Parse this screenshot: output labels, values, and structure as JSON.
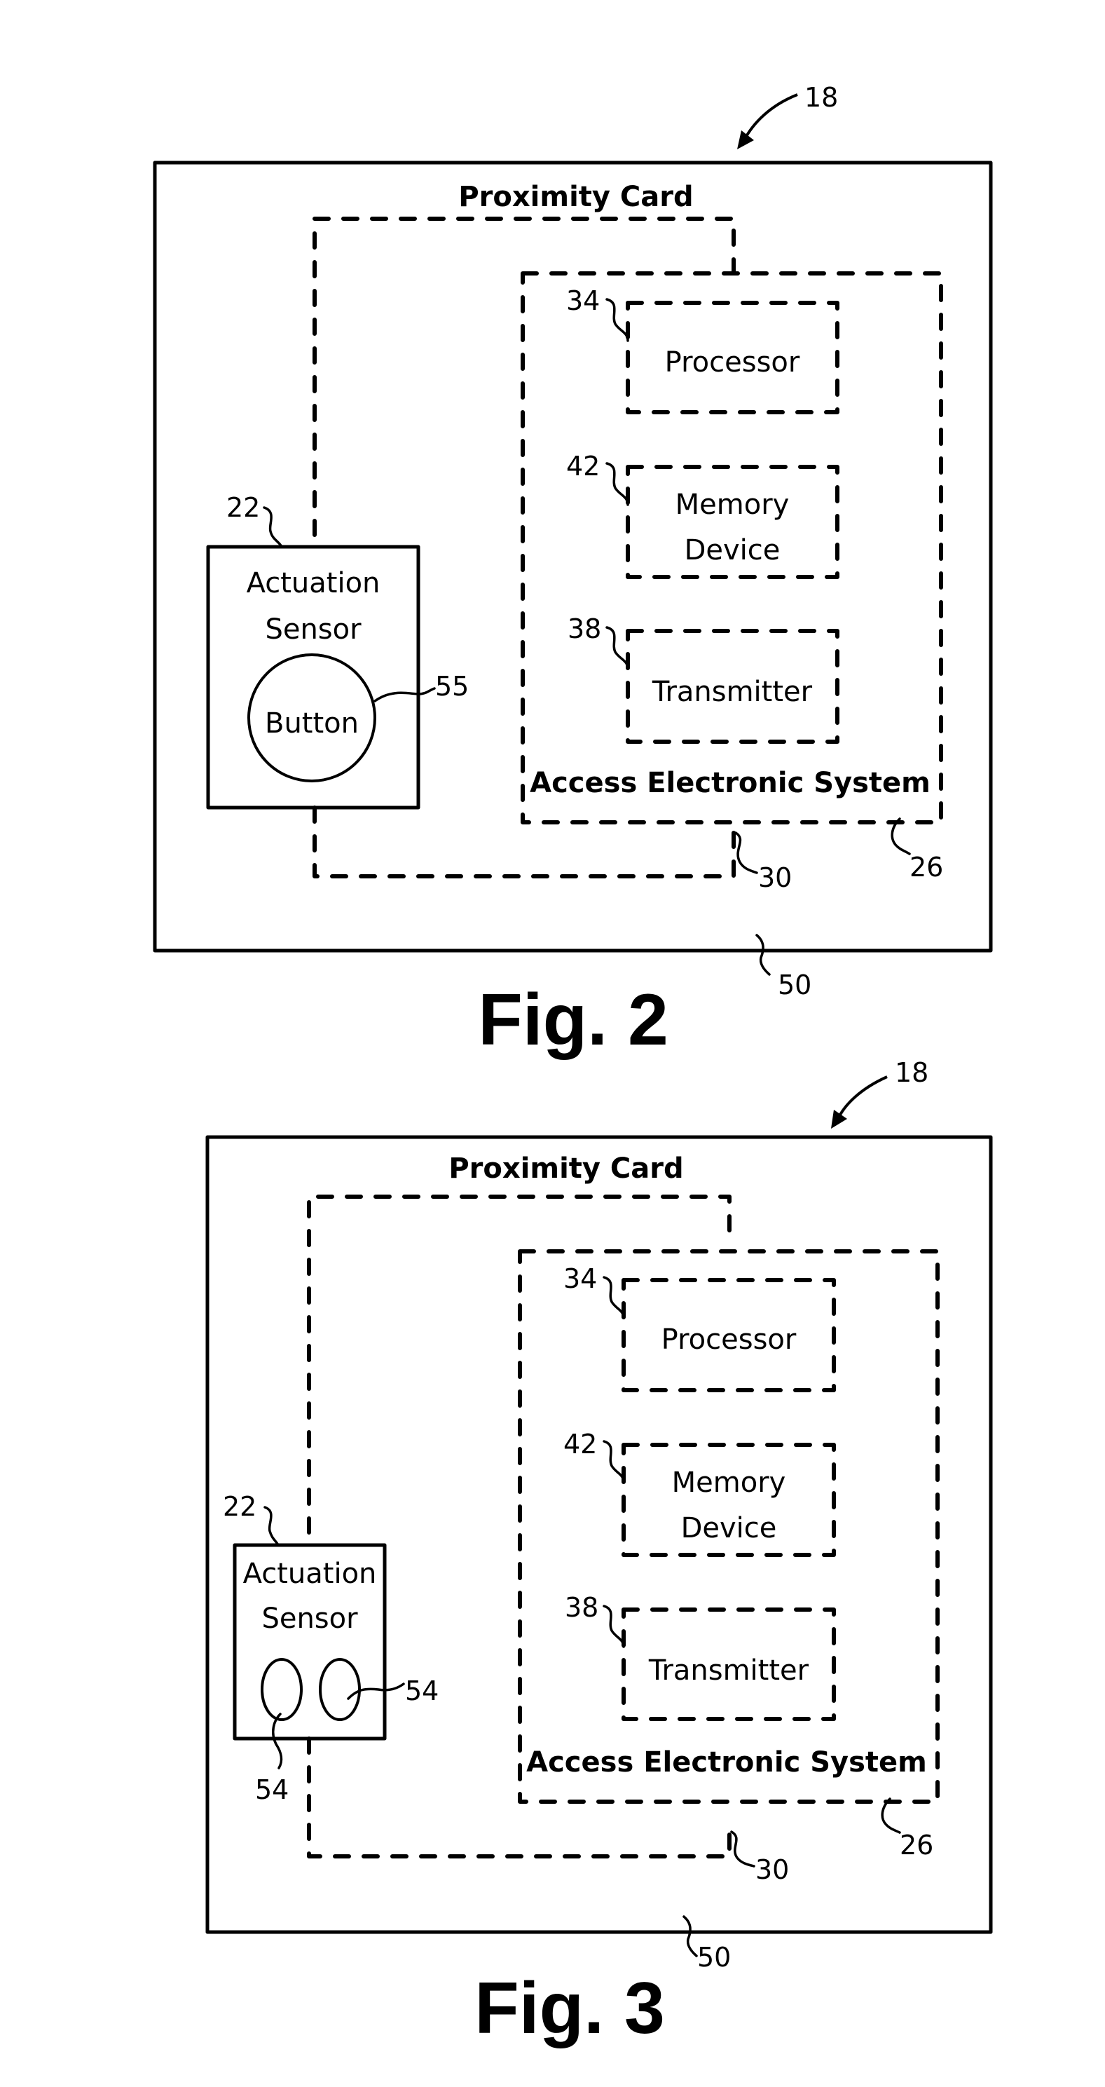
{
  "figures": [
    {
      "caption": "Fig. 2",
      "card_label": "Proximity Card",
      "system_label": "Access Electronic System",
      "sensor_label_line1": "Actuation",
      "sensor_label_line2": "Sensor",
      "button_label": "Button",
      "components": [
        {
          "ref": "34",
          "label_line1": "Processor",
          "label_line2": ""
        },
        {
          "ref": "42",
          "label_line1": "Memory",
          "label_line2": "Device"
        },
        {
          "ref": "38",
          "label_line1": "Transmitter",
          "label_line2": ""
        }
      ],
      "refs": {
        "device": "18",
        "sensor": "22",
        "system": "26",
        "link": "30",
        "card_body": "50",
        "button": "55"
      }
    },
    {
      "caption": "Fig. 3",
      "card_label": "Proximity Card",
      "system_label": "Access Electronic System",
      "sensor_label_line1": "Actuation",
      "sensor_label_line2": "Sensor",
      "components": [
        {
          "ref": "34",
          "label_line1": "Processor",
          "label_line2": ""
        },
        {
          "ref": "42",
          "label_line1": "Memory",
          "label_line2": "Device"
        },
        {
          "ref": "38",
          "label_line1": "Transmitter",
          "label_line2": ""
        }
      ],
      "refs": {
        "device": "18",
        "sensor": "22",
        "system": "26",
        "link": "30",
        "card_body": "50",
        "contact_left": "54",
        "contact_right": "54"
      }
    }
  ]
}
